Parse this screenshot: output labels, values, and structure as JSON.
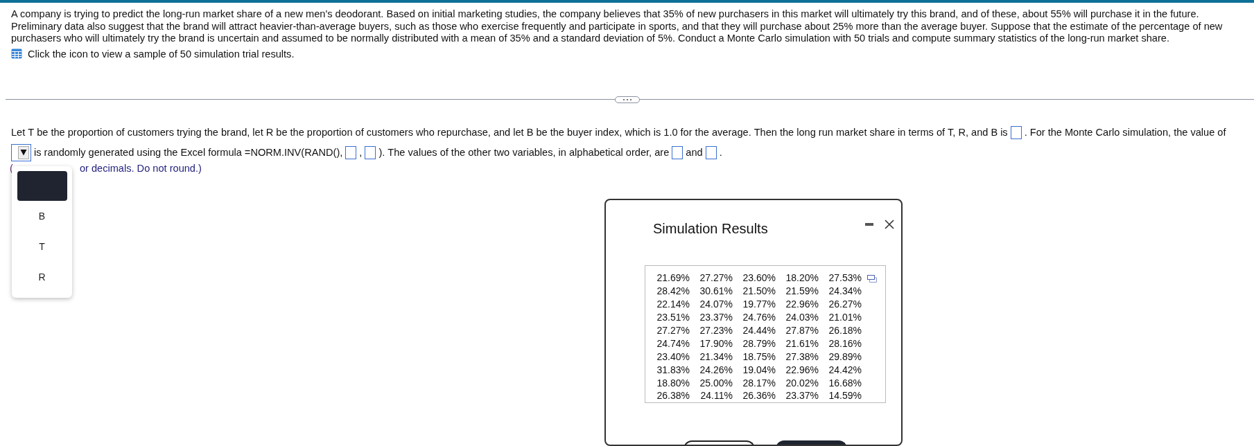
{
  "problem": {
    "text": "A company is trying to predict the long-run market share of a new men's deodorant. Based on initial marketing studies, the company believes that 35% of new purchasers in this market will ultimately try this brand, and of these, about 55% will purchase it in the future. Preliminary data also suggest that the brand will attract heavier-than-average buyers, such as those who exercise frequently and participate in sports, and that they will purchase about 25% more than the average buyer. Suppose that the estimate of the percentage of new purchasers who will ultimately try the brand is uncertain and assumed to be normally distributed with a mean of 35% and a standard deviation of 5%. Conduct a Monte Carlo simulation with 50 trials and compute summary statistics of the long-run market share.",
    "link": "Click the icon to view a sample of 50 simulation trial results."
  },
  "question": [
    {
      "kind": "text",
      "text": "Let T be the proportion of customers trying the brand, let R be the proportion of customers who repurchase, and let B be the buyer index, which is 1.0 for the average. Then the long run market share in terms of T, R, and B is"
    },
    {
      "kind": "box"
    },
    {
      "kind": "text",
      "text": ". For the Monte Carlo simulation, the value of"
    },
    {
      "kind": "dropdown"
    },
    {
      "kind": "text",
      "text": "is randomly generated using the Excel formula =NORM.INV(RAND(),"
    },
    {
      "kind": "box"
    },
    {
      "kind": "text",
      "text": ","
    },
    {
      "kind": "box"
    },
    {
      "kind": "text",
      "text": "). The values of the other two variables, in alphabetical order, are"
    },
    {
      "kind": "box"
    },
    {
      "kind": "text",
      "text": "and"
    },
    {
      "kind": "box"
    },
    {
      "kind": "text",
      "text": "."
    }
  ],
  "note": [
    "(",
    "or decimals. Do not round.)"
  ],
  "dropdown_menu": {
    "highlighted_blank": true,
    "items": [
      {
        "label": "B"
      },
      {
        "label": "T"
      },
      {
        "label": "R"
      }
    ]
  },
  "dialog": {
    "title": "Simulation Results",
    "rows": [
      [
        "21.69%",
        "27.27%",
        "23.60%",
        "18.20%",
        "27.53%"
      ],
      [
        "28.42%",
        "30.61%",
        "21.50%",
        "21.59%",
        "24.34%"
      ],
      [
        "22.14%",
        "24.07%",
        "19.77%",
        "22.96%",
        "26.27%"
      ],
      [
        "23.51%",
        "23.37%",
        "24.76%",
        "24.03%",
        "21.01%"
      ],
      [
        "27.27%",
        "27.23%",
        "24.44%",
        "27.87%",
        "26.18%"
      ],
      [
        "24.74%",
        "17.90%",
        "28.79%",
        "21.61%",
        "28.16%"
      ],
      [
        "23.40%",
        "21.34%",
        "18.75%",
        "27.38%",
        "29.89%"
      ],
      [
        "31.83%",
        "24.26%",
        "19.04%",
        "22.96%",
        "24.42%"
      ],
      [
        "18.80%",
        "25.00%",
        "28.17%",
        "20.02%",
        "16.68%"
      ],
      [
        "26.38%",
        "24.11%",
        "26.36%",
        "23.37%",
        "14.59%"
      ]
    ],
    "buttons": [
      {
        "kind": "outline"
      },
      {
        "kind": "filled"
      }
    ]
  }
}
